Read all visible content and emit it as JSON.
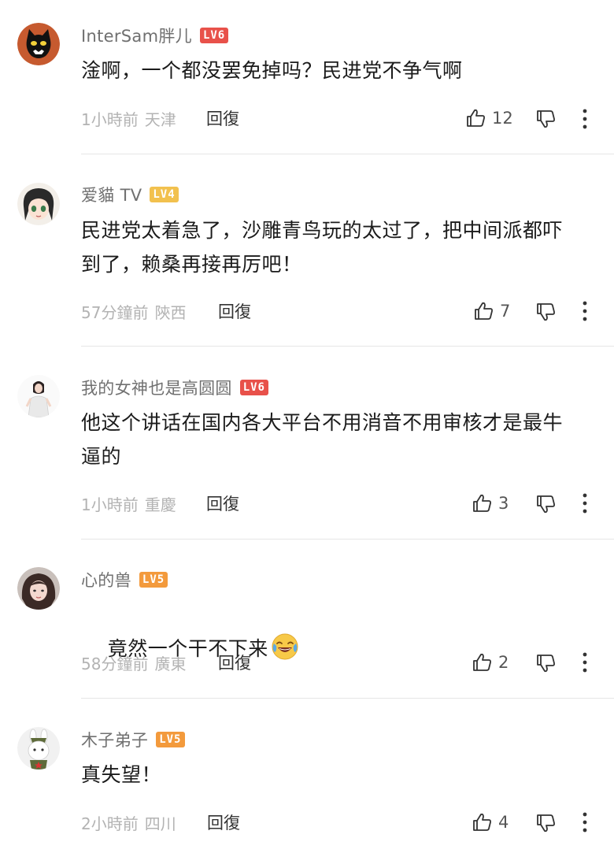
{
  "comments": [
    {
      "username": "InterSam胖儿",
      "level": "LV6",
      "text": "淦啊，一个都没罢免掉吗？民进党不争气啊",
      "time": "1小時前",
      "location": "天津",
      "reply_label": "回復",
      "likes": "12",
      "avatar": "black-cat-face-avatar"
    },
    {
      "username": "爱貓 TV",
      "level": "LV4",
      "text": "民进党太着急了，沙雕青鸟玩的太过了，把中间派都吓\n到了，赖桑再接再厉吧！",
      "time": "57分鐘前",
      "location": "陝西",
      "reply_label": "回復",
      "likes": "7",
      "avatar": "anime-girl-avatar"
    },
    {
      "username": "我的女神也是高圆圆",
      "level": "LV6",
      "text": "他这个讲话在国内各大平台不用消音不用审核才是最牛\n逼的",
      "time": "1小時前",
      "location": "重慶",
      "reply_label": "回復",
      "likes": "3",
      "avatar": "woman-in-white-avatar"
    },
    {
      "username": "心的兽",
      "level": "LV5",
      "text": "竟然一个干不下来",
      "time": "58分鐘前",
      "location": "廣東",
      "reply_label": "回復",
      "likes": "2",
      "avatar": "girl-photo-avatar",
      "emoji": "crying-laughing-emoji"
    },
    {
      "username": "木子弟子",
      "level": "LV5",
      "text": "真失望！",
      "time": "2小時前",
      "location": "四川",
      "reply_label": "回復",
      "likes": "4",
      "avatar": "cartoon-rabbit-avatar"
    }
  ],
  "icons": {
    "like": "thumbs-up-icon",
    "dislike": "thumbs-down-icon",
    "more": "more-vertical-icon"
  }
}
